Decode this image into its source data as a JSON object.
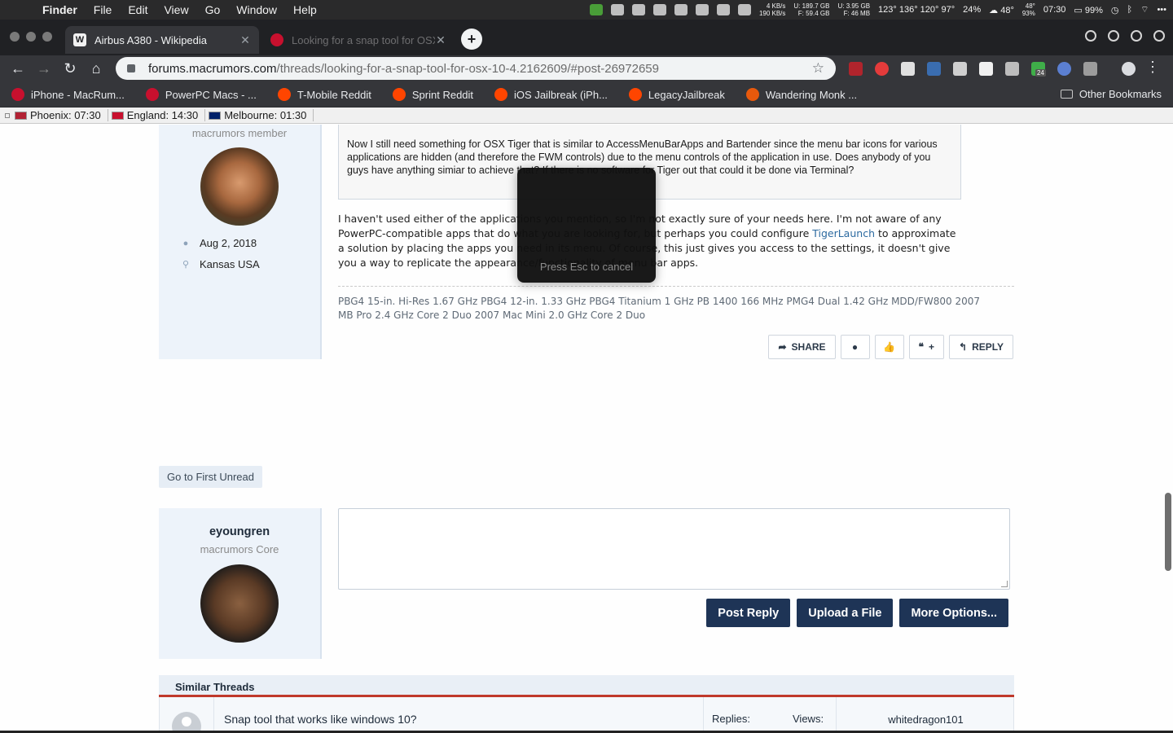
{
  "menubar": {
    "app": "Finder",
    "items": [
      "File",
      "Edit",
      "View",
      "Go",
      "Window",
      "Help"
    ],
    "net_up": "4 KB/s",
    "net_down": "190 KB/s",
    "disk_u": "189.7 GB",
    "disk_f": "59.4 GB",
    "mem_u": "3.95 GB",
    "mem_f": "46 MB",
    "temps": "123° 136° 120° 97°",
    "cpu": "24%",
    "weather": "48°",
    "weather_hi": "48°",
    "humidity": "93%",
    "clock_time": "07:30",
    "battery": "99%"
  },
  "browser": {
    "tabs": [
      {
        "title": "Airbus A380 - Wikipedia",
        "favicon": "W"
      },
      {
        "title": "Looking for a snap tool for OSX",
        "favicon": "macrumors-icon"
      }
    ],
    "url_host": "forums.macrumors.com",
    "url_path": "/threads/looking-for-a-snap-tool-for-osx-10-4.2162609/#post-26972659",
    "badge_count": "24",
    "bookmarks": [
      "iPhone - MacRum...",
      "PowerPC Macs - ...",
      "T-Mobile Reddit",
      "Sprint Reddit",
      "iOS Jailbreak (iPh...",
      "LegacyJailbreak",
      "Wandering Monk ..."
    ],
    "other_bookmarks": "Other Bookmarks"
  },
  "clocks": [
    {
      "label": "Phoenix: 07:30"
    },
    {
      "label": "England: 14:30"
    },
    {
      "label": "Melbourne: 01:30"
    }
  ],
  "post": {
    "member_title": "macrumors member",
    "joined": "Aug 2, 2018",
    "location": "Kansas USA",
    "quote": "Now I still need something for OSX Tiger that is similar to AccessMenuBarApps and Bartender since the menu bar icons for various applications are hidden (and therefore the FWM controls) due to the menu controls of the application in use. Does anybody of you guys have anything simiar to achieve that? If there is no software for Tiger out that could it be done via Terminal?",
    "body_before": "I haven't used either of the applications you mention, so I'm not exactly sure of your needs here. I'm not aware of any PowerPC-compatible apps that do what you are looking for, but perhaps you could configure ",
    "body_link": "TigerLaunch",
    "body_after": " to approximate a solution by placing the apps you need in its menu. Of course, this just gives you access to the settings, it doesn't give you a way to replicate the appearance/functionality of menu bar apps.",
    "signature": [
      "PBG4 15-in. Hi-Res 1.67 GHz",
      "PBG4 12-in. 1.33 GHz",
      "PBG4 Titanium 1 GHz",
      "PB 1400 166 MHz",
      "PMG4 Dual 1.42 GHz MDD/FW800",
      "2007 MB Pro 2.4 GHz Core 2 Duo",
      "2007 Mac Mini 2.0 GHz Core 2 Duo"
    ],
    "actions": {
      "share": "SHARE",
      "quote_plus": "+",
      "reply": "REPLY"
    }
  },
  "go_first_unread": "Go to First Unread",
  "reply_form": {
    "username": "eyoungren",
    "member_title": "macrumors Core",
    "post_reply": "Post Reply",
    "upload": "Upload a File",
    "more": "More Options..."
  },
  "similar": {
    "heading": "Similar Threads",
    "rows": [
      {
        "title": "Snap tool that works like windows 10?",
        "replies_label": "Replies:",
        "views_label": "Views:",
        "last_user": "whitedragon101"
      }
    ]
  },
  "popup": {
    "message": "Press Esc to cancel"
  }
}
